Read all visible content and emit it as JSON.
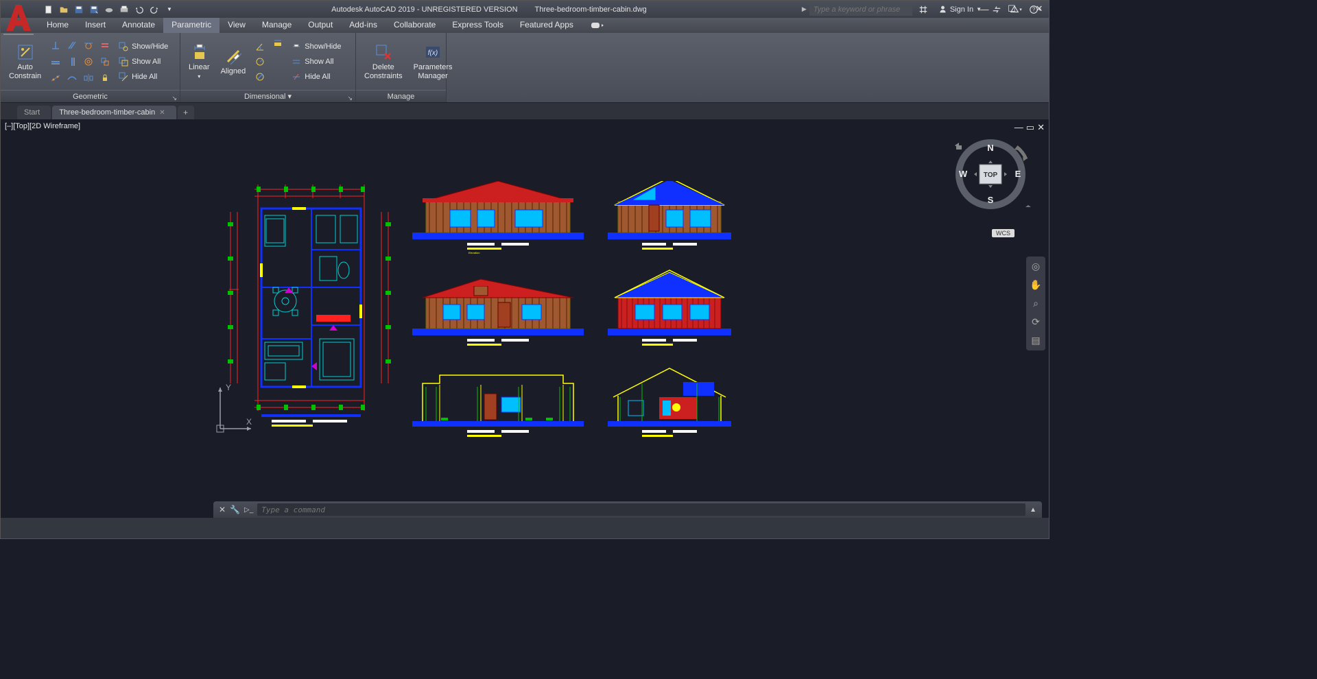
{
  "title": {
    "app": "Autodesk AutoCAD 2019 - UNREGISTERED VERSION",
    "file": "Three-bedroom-timber-cabin.dwg"
  },
  "search_placeholder": "Type a keyword or phrase",
  "signin_label": "Sign In",
  "menu_tabs": [
    "Home",
    "Insert",
    "Annotate",
    "Parametric",
    "View",
    "Manage",
    "Output",
    "Add-ins",
    "Collaborate",
    "Express Tools",
    "Featured Apps"
  ],
  "active_menu": "Parametric",
  "ribbon": {
    "geometric": {
      "title": "Geometric",
      "auto": "Auto\nConstrain",
      "cmds": [
        "Show/Hide",
        "Show All",
        "Hide All"
      ]
    },
    "dimensional": {
      "title": "Dimensional",
      "linear": "Linear",
      "aligned": "Aligned",
      "cmds": [
        "Show/Hide",
        "Show All",
        "Hide All"
      ]
    },
    "manage": {
      "title": "Manage",
      "delete": "Delete\nConstraints",
      "params": "Parameters\nManager"
    }
  },
  "file_tabs": {
    "start": "Start",
    "current": "Three-bedroom-timber-cabin"
  },
  "viewport_label": "[–][Top][2D Wireframe]",
  "viewcube": {
    "top": "TOP",
    "n": "N",
    "s": "S",
    "e": "E",
    "w": "W"
  },
  "wcs_label": "WCS",
  "ucs": {
    "x": "X",
    "y": "Y"
  },
  "command_placeholder": "Type a command",
  "colors": {
    "roof": "#cc2020",
    "wall": "#a05830",
    "window": "#00bfff",
    "blue": "#1030ff",
    "yellow": "#ffff00",
    "green": "#00c000",
    "magenta": "#d000d0",
    "cyan": "#00d0d0"
  }
}
